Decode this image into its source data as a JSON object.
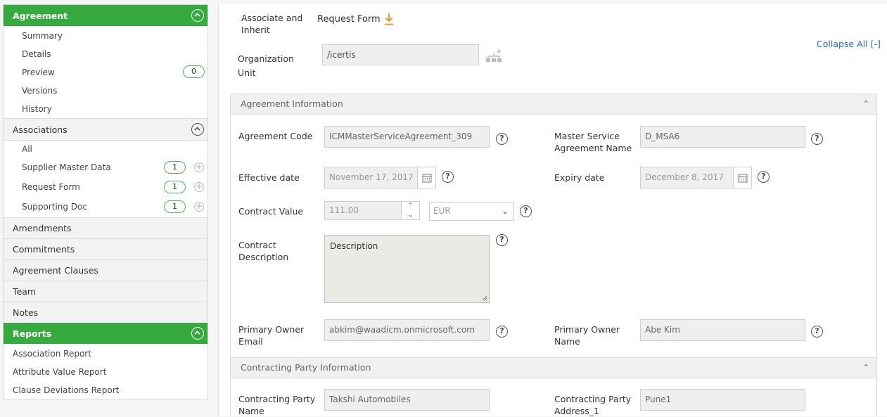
{
  "sidebar": {
    "agreement": {
      "title": "Agreement",
      "items": [
        "Summary",
        "Details",
        "Preview",
        "Versions",
        "History"
      ],
      "preview_count": "0"
    },
    "associations": {
      "title": "Associations",
      "items": [
        {
          "label": "All"
        },
        {
          "label": "Supplier Master Data",
          "count": "1"
        },
        {
          "label": "Request Form",
          "count": "1"
        },
        {
          "label": "Supporting Doc",
          "count": "1"
        }
      ]
    },
    "sections": [
      "Amendments",
      "Commitments",
      "Agreement Clauses",
      "Team",
      "Notes"
    ],
    "reports": {
      "title": "Reports",
      "items": [
        "Association Report",
        "Attribute Value Report",
        "Clause Deviations Report"
      ]
    }
  },
  "main": {
    "associate_inherit_label": "Associate and Inherit",
    "request_form_label": "Request Form",
    "org_unit_label": "Organization Unit",
    "org_unit_value": "/icertis",
    "collapse_all": "Collapse All [-]",
    "agreement_info": {
      "title": "Agreement Information",
      "agreement_code_label": "Agreement Code",
      "agreement_code_value": "ICMMasterServiceAgreement_309",
      "msa_name_label": "Master Service Agreement Name",
      "msa_name_value": "D_MSA6",
      "effective_date_label": "Effective date",
      "effective_date_value": "November 17, 2017",
      "expiry_date_label": "Expiry date",
      "expiry_date_value": "December 8, 2017",
      "contract_value_label": "Contract Value",
      "contract_value_value": "111.00",
      "currency_value": "EUR",
      "contract_desc_label": "Contract Description",
      "contract_desc_value": "Description",
      "owner_email_label": "Primary Owner Email",
      "owner_email_value": "abkim@waadicm.onmicrosoft.com",
      "owner_name_label": "Primary Owner Name",
      "owner_name_value": "Abe Kim"
    },
    "contracting_party": {
      "title": "Contracting Party Information",
      "party_name_label": "Contracting Party Name",
      "party_name_value": "Takshi Automobiles",
      "party_address_label": "Contracting Party Address_1",
      "party_address_value": "Pune1"
    },
    "help_glyph": "?"
  },
  "colors": {
    "accent_green": "#36a93f",
    "download_orange": "#e0962a",
    "link_blue": "#2a6ebb"
  }
}
